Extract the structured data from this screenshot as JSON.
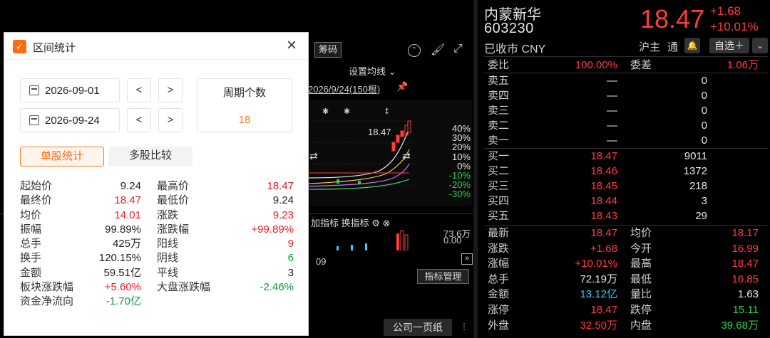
{
  "chart_panel": {
    "chip_label": "筹码",
    "ma_setting": "设置均线",
    "range_label": "2026/9/24(150根)",
    "last_price_label": "18.47",
    "pct_axis": [
      {
        "label": "40%",
        "color": "#e6e6e6"
      },
      {
        "label": "30%",
        "color": "#e6e6e6"
      },
      {
        "label": "20%",
        "color": "#e6e6e6"
      },
      {
        "label": "10%",
        "color": "#e6e6e6"
      },
      {
        "label": "0%",
        "color": "#e6e6e6"
      },
      {
        "label": "-10%",
        "color": "#2fd14a"
      },
      {
        "label": "-20%",
        "color": "#2fd14a"
      },
      {
        "label": "-30%",
        "color": "#2fd14a"
      }
    ],
    "add_indicator": "加指标",
    "switch_indicator": "换指标",
    "vol_max": "73.6万",
    "vol_min": "0.00",
    "date_tick": "09",
    "indicator_manage": "指标管理",
    "company_page": "公司一页纸"
  },
  "dialog": {
    "title": "区间统计",
    "start_date": "2026-09-01",
    "end_date": "2026-09-24",
    "prev": "<",
    "next": ">",
    "period_title": "周期个数",
    "period_value": "18",
    "tab_single": "单股统计",
    "tab_multi": "多股比较",
    "stats": [
      [
        {
          "label": "起始价",
          "value": "9.24",
          "color": "dark"
        },
        {
          "label": "最高价",
          "value": "18.47",
          "color": "red"
        }
      ],
      [
        {
          "label": "最终价",
          "value": "18.47",
          "color": "red"
        },
        {
          "label": "最低价",
          "value": "9.24",
          "color": "dark"
        }
      ],
      [
        {
          "label": "均价",
          "value": "14.01",
          "color": "red"
        },
        {
          "label": "涨跌",
          "value": "9.23",
          "color": "red"
        }
      ],
      [
        {
          "label": "振幅",
          "value": "99.89%",
          "color": "dark"
        },
        {
          "label": "涨跌幅",
          "value": "+99.89%",
          "color": "red"
        }
      ],
      [
        {
          "label": "总手",
          "value": "425万",
          "color": "dark"
        },
        {
          "label": "阳线",
          "value": "9",
          "color": "red"
        }
      ],
      [
        {
          "label": "换手",
          "value": "120.15%",
          "color": "dark"
        },
        {
          "label": "阴线",
          "value": "6",
          "color": "green"
        }
      ],
      [
        {
          "label": "金额",
          "value": "59.51亿",
          "color": "dark"
        },
        {
          "label": "平线",
          "value": "3",
          "color": "dark"
        }
      ],
      [
        {
          "label": "板块涨跌幅",
          "value": "+5.60%",
          "color": "red"
        },
        {
          "label": "大盘涨跌幅",
          "value": "-2.46%",
          "color": "green"
        }
      ],
      [
        {
          "label": "资金净流向",
          "value": "-1.70亿",
          "color": "green"
        },
        null
      ]
    ]
  },
  "quote": {
    "name": "内蒙新华",
    "code": "603230",
    "price": "18.47",
    "change": "+1.68",
    "change_pct": "+10.01%",
    "status": "已收市 CNY",
    "market": "沪主",
    "tong": "通",
    "watch": "自选",
    "weibi_label": "委比",
    "weibi_value": "100.00%",
    "weicha_label": "委差",
    "weicha_value": "1.06万",
    "sell": [
      {
        "label": "卖五",
        "price": "—",
        "vol": "0"
      },
      {
        "label": "卖四",
        "price": "—",
        "vol": "0"
      },
      {
        "label": "卖三",
        "price": "—",
        "vol": "0"
      },
      {
        "label": "卖二",
        "price": "—",
        "vol": "0"
      },
      {
        "label": "卖一",
        "price": "—",
        "vol": "0"
      }
    ],
    "buy": [
      {
        "label": "买一",
        "price": "18.47",
        "vol": "9011"
      },
      {
        "label": "买二",
        "price": "18.46",
        "vol": "1372"
      },
      {
        "label": "买三",
        "price": "18.45",
        "vol": "218"
      },
      {
        "label": "买四",
        "price": "18.44",
        "vol": "3"
      },
      {
        "label": "买五",
        "price": "18.43",
        "vol": "29"
      }
    ],
    "details": [
      [
        {
          "label": "最新",
          "value": "18.47",
          "color": "red"
        },
        {
          "label": "均价",
          "value": "18.17",
          "color": "red"
        }
      ],
      [
        {
          "label": "涨跌",
          "value": "+1.68",
          "color": "red"
        },
        {
          "label": "今开",
          "value": "16.99",
          "color": "red"
        }
      ],
      [
        {
          "label": "涨幅",
          "value": "+10.01%",
          "color": "red"
        },
        {
          "label": "最高",
          "value": "18.47",
          "color": "red"
        }
      ],
      [
        {
          "label": "总手",
          "value": "72.19万",
          "color": "white"
        },
        {
          "label": "最低",
          "value": "16.85",
          "color": "red"
        }
      ],
      [
        {
          "label": "金额",
          "value": "13.12亿",
          "color": "cyan"
        },
        {
          "label": "量比",
          "value": "1.63",
          "color": "white"
        }
      ],
      [
        {
          "label": "涨停",
          "value": "18.47",
          "color": "red"
        },
        {
          "label": "跌停",
          "value": "15.11",
          "color": "green"
        }
      ],
      [
        {
          "label": "外盘",
          "value": "32.50万",
          "color": "red"
        },
        {
          "label": "内盘",
          "value": "39.68万",
          "color": "green"
        }
      ]
    ]
  }
}
